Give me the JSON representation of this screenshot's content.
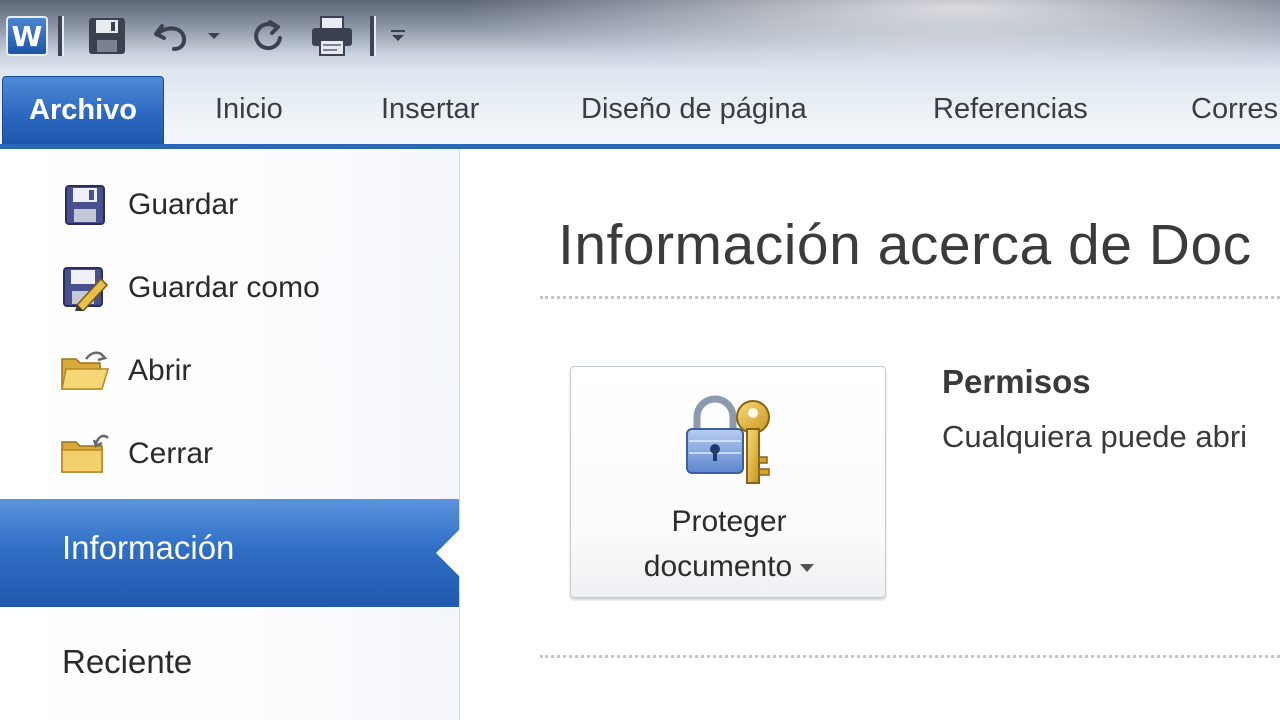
{
  "quick_access": {
    "app_logo": "W",
    "icons": [
      "word-logo-icon",
      "save-icon",
      "undo-icon",
      "undo-dropdown-icon",
      "redo-icon",
      "print-icon",
      "customize-icon"
    ]
  },
  "ribbon": {
    "tabs": [
      {
        "label": "Archivo",
        "active": true
      },
      {
        "label": "Inicio"
      },
      {
        "label": "Insertar"
      },
      {
        "label": "Diseño de página"
      },
      {
        "label": "Referencias"
      },
      {
        "label": "Corres"
      }
    ],
    "accent": "#2a67b7"
  },
  "backstage_menu": {
    "items": [
      {
        "label": "Guardar",
        "icon": "save-icon"
      },
      {
        "label": "Guardar como",
        "icon": "save-as-icon"
      },
      {
        "label": "Abrir",
        "icon": "open-folder-icon"
      },
      {
        "label": "Cerrar",
        "icon": "close-folder-icon"
      },
      {
        "label": "Información",
        "selected": true
      },
      {
        "label": "Reciente"
      }
    ]
  },
  "info_panel": {
    "title": "Información acerca de Doc",
    "protect_button": {
      "line1": "Proteger",
      "line2": "documento",
      "icon": "lock-key-icon"
    },
    "permissions": {
      "title": "Permisos",
      "description": "Cualquiera puede abri"
    }
  }
}
